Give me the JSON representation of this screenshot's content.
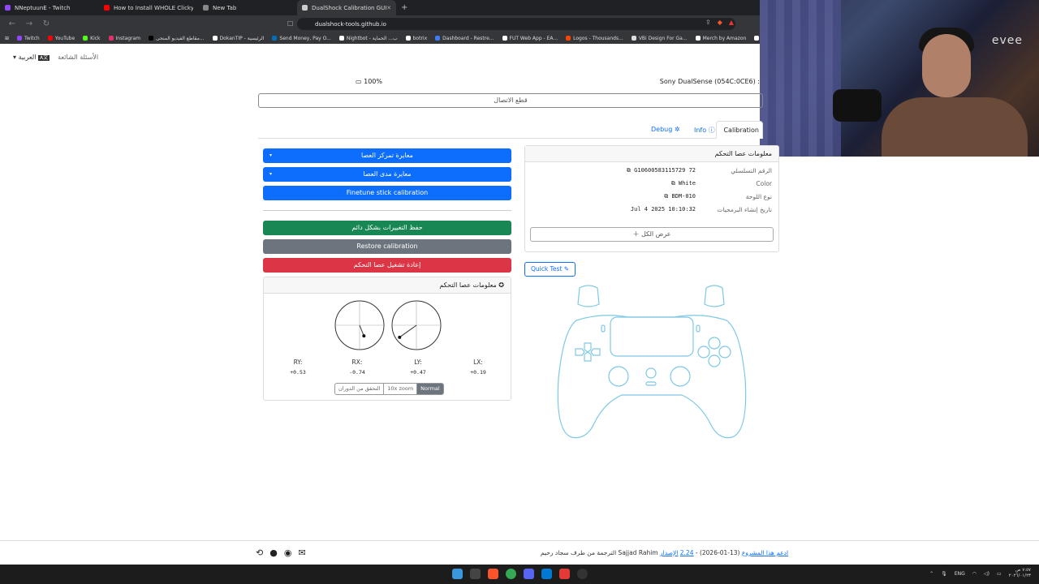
{
  "browser": {
    "tabs": [
      {
        "label": "NNeptuunE - Twitch",
        "color": "#9146ff"
      },
      {
        "label": "How to Install WHOLE Clicky Kit on P",
        "color": "#ff0000"
      },
      {
        "label": "New Tab",
        "color": "#888888"
      },
      {
        "label": "DualShock Calibration GUI",
        "color": "#cccccc",
        "active": true
      }
    ],
    "new_tab": "+",
    "url": "dualshock-tools.github.io",
    "bookmarks": [
      {
        "label": "Twitch",
        "color": "#9146ff"
      },
      {
        "label": "YouTube",
        "color": "#ff0000"
      },
      {
        "label": "Kick",
        "color": "#53fc18"
      },
      {
        "label": "Instagram",
        "color": "#e1306c"
      },
      {
        "label": "مقاطع الفيديو المنحى...",
        "color": "#000000"
      },
      {
        "label": "DokanTIP - الرئيسية",
        "color": "#ffffff"
      },
      {
        "label": "Send Money, Pay O...",
        "color": "#0070ba"
      },
      {
        "label": "Nightbot - ب... الحماية",
        "color": "#ffffff"
      },
      {
        "label": "botrix",
        "color": "#ffffff"
      },
      {
        "label": "Dashboard - Restre...",
        "color": "#3f7cf7"
      },
      {
        "label": "FUT Web App - EA...",
        "color": "#ffffff"
      },
      {
        "label": "Logos - Thousands...",
        "color": "#ff4400"
      },
      {
        "label": "VBi Design For Ga...",
        "color": "#dddddd"
      },
      {
        "label": "Merch by Amazon",
        "color": "#ffffff"
      },
      {
        "label": "Video to and",
        "color": "#ffffff"
      }
    ]
  },
  "webcam": {
    "logo": "evee"
  },
  "app": {
    "nav": {
      "faq": "الأسئلة الشائعة",
      "language": "العربية"
    },
    "battery": "100%",
    "device": "Sony DualSense (054C:0CE6) :",
    "disconnect": "قطع الاتصال",
    "tabs": {
      "debug": "Debug",
      "info": "Info",
      "calibration": "Calibration"
    },
    "buttons": {
      "center_cal": "معايرة تمركز العصا",
      "range_cal": "معايرة مدى العصا",
      "finetune": "Finetune stick calibration",
      "save": "حفظ التغييرات بشكل دائم",
      "restore": "Restore calibration",
      "reboot": "إعادة تشغيل عصا التحكم"
    },
    "info_card": {
      "title": "معلومات عصا التحكم",
      "rows": [
        {
          "key": "الرقم التسلسلي",
          "value": "G10600583115729 72"
        },
        {
          "key": "Color",
          "value": "White"
        },
        {
          "key": "نوع اللوحة",
          "value": "BDM-010"
        },
        {
          "key": "تاريخ إنشاء البرمجيات",
          "value": "Jul  4 2025 10:10:32"
        }
      ],
      "show_all": "عرض الكل"
    },
    "quick_test": "Quick Test",
    "stick_card": {
      "title": "معلومات عصا التحكم",
      "axes": [
        {
          "name": "RY:",
          "value": "+0.53"
        },
        {
          "name": "RX:",
          "value": "-0.74"
        },
        {
          "name": "LY:",
          "value": "+0.47"
        },
        {
          "name": "LX:",
          "value": "+0.19"
        }
      ],
      "zoom": {
        "check": "التحقق من الدوران",
        "x10": "10x zoom",
        "normal": "Normal"
      }
    },
    "footer": {
      "version_label": "الإصدار",
      "version": "2.24",
      "date": "(13-01-2026) -",
      "support": "ادعم هذا المشروع",
      "credit": "الترجمة من طرف سجاد رحيم Sajjad Rahim"
    }
  },
  "taskbar": {
    "lang": "ENG",
    "time": "٧:٥٧ ص",
    "date": "٢٠٢٦/٠١/٢٣"
  }
}
